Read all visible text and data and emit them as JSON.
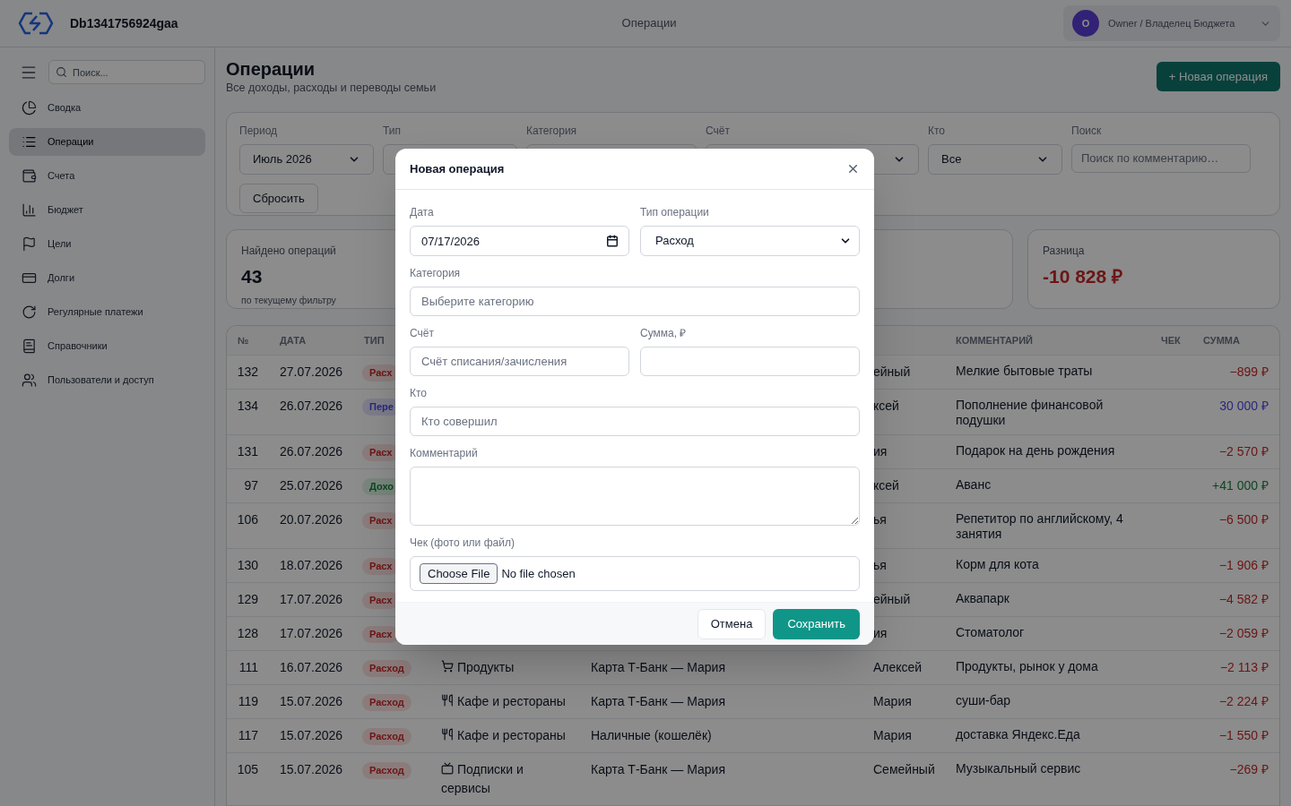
{
  "app": {
    "name": "Db1341756924gaa"
  },
  "header": {
    "title": "Операции",
    "user": {
      "initial": "О",
      "label": "Owner / Владелец Бюджета"
    }
  },
  "sidebar": {
    "search_placeholder": "Поиск...",
    "items": [
      {
        "label": "Сводка",
        "selected": false
      },
      {
        "label": "Операции",
        "selected": true
      },
      {
        "label": "Счета",
        "selected": false
      },
      {
        "label": "Бюджет",
        "selected": false
      },
      {
        "label": "Цели",
        "selected": false
      },
      {
        "label": "Долги",
        "selected": false
      },
      {
        "label": "Регулярные платежи",
        "selected": false
      },
      {
        "label": "Справочники",
        "selected": false
      },
      {
        "label": "Пользователи и доступ",
        "selected": false
      }
    ]
  },
  "page": {
    "title": "Операции",
    "subtitle": "Все доходы, расходы и переводы семьи",
    "new_button": "+ Новая операция"
  },
  "filters": {
    "fields": [
      {
        "label": "Период",
        "kind": "select",
        "value": "Июль 2026"
      },
      {
        "label": "Тип",
        "kind": "select"
      },
      {
        "label": "Категория",
        "kind": "select"
      },
      {
        "label": "Счёт",
        "kind": "select"
      },
      {
        "label": "Кто",
        "kind": "select",
        "value": "Все"
      },
      {
        "label": "Поиск",
        "kind": "input",
        "placeholder": "Поиск по комментарию…"
      }
    ],
    "reset": "Сбросить"
  },
  "summary": {
    "found": {
      "label": "Найдено операций",
      "value": "43",
      "note": "по текущему фильтру"
    },
    "difference": {
      "label": "Разница",
      "value": "-10 828 ₽",
      "kind": "expense"
    }
  },
  "table": {
    "columns": [
      "№",
      "ДАТА",
      "ТИП",
      "КОММЕНТАРИЙ",
      "ЧЕК",
      "СУММА"
    ],
    "rows": [
      {
        "num": "132",
        "date": "27.07.2026",
        "kind": "expense",
        "type": "Расх",
        "who": "ейный",
        "comment": "Мелкие бытовые траты",
        "amount": "−899 ₽"
      },
      {
        "num": "134",
        "date": "26.07.2026",
        "kind": "transfer",
        "type": "Пере",
        "who": "ксей",
        "comment": "Пополнение финансовой подушки",
        "amount": "30 000 ₽"
      },
      {
        "num": "131",
        "date": "26.07.2026",
        "kind": "expense",
        "type": "Расх",
        "who": "ия",
        "comment": "Подарок на день рождения",
        "amount": "−2 570 ₽"
      },
      {
        "num": "97",
        "date": "25.07.2026",
        "kind": "income",
        "type": "Дохо",
        "who": "ксей",
        "comment": "Аванс",
        "amount": "+41 000 ₽"
      },
      {
        "num": "106",
        "date": "20.07.2026",
        "kind": "expense",
        "type": "Расх",
        "who": "ья",
        "comment": "Репетитор по английскому, 4 занятия",
        "amount": "−6 500 ₽"
      },
      {
        "num": "130",
        "date": "18.07.2026",
        "kind": "expense",
        "type": "Расх",
        "who": "ья",
        "comment": "Корм для кота",
        "amount": "−1 906 ₽"
      },
      {
        "num": "129",
        "date": "17.07.2026",
        "kind": "expense",
        "type": "Расх",
        "who": "ейный",
        "comment": "Аквапарк",
        "amount": "−4 582 ₽"
      },
      {
        "num": "128",
        "date": "17.07.2026",
        "kind": "expense",
        "type": "Расх",
        "who": "ия",
        "comment": "Стоматолог",
        "amount": "−2 059 ₽"
      },
      {
        "num": "111",
        "date": "16.07.2026",
        "kind": "expense",
        "type": "Расход",
        "category": {
          "kind": "groceries",
          "label": "Продукты"
        },
        "account": "Карта Т-Банк — Мария",
        "who": "Алексей",
        "comment": "Продукты, рынок у дома",
        "amount": "−2 113 ₽"
      },
      {
        "num": "119",
        "date": "15.07.2026",
        "kind": "expense",
        "type": "Расход",
        "category": {
          "kind": "dining",
          "label": "Кафе и рестораны"
        },
        "account": "Карта Т-Банк — Мария",
        "who": "Мария",
        "comment": "суши-бар",
        "amount": "−2 224 ₽"
      },
      {
        "num": "117",
        "date": "15.07.2026",
        "kind": "expense",
        "type": "Расход",
        "category": {
          "kind": "dining",
          "label": "Кафе и рестораны"
        },
        "account": "Наличные (кошелёк)",
        "who": "Мария",
        "comment": "доставка Яндекс.Еда",
        "amount": "−1 550 ₽"
      },
      {
        "num": "105",
        "date": "15.07.2026",
        "kind": "expense",
        "type": "Расход",
        "category": {
          "kind": "subscriptions",
          "label": "Подписки и сервисы"
        },
        "account": "Карта Т-Банк — Мария",
        "who": "Семейный",
        "comment": "Музыкальный сервис",
        "amount": "−269 ₽"
      }
    ]
  },
  "dialog": {
    "title": "Новая операция",
    "rows": [
      [
        {
          "label": "Дата",
          "kind": "date",
          "value": "07/17/2026"
        },
        {
          "label": "Тип операции",
          "kind": "select",
          "value": "Расход"
        }
      ],
      [
        {
          "label": "Категория",
          "kind": "input",
          "placeholder": "Выберите категорию"
        }
      ],
      [
        {
          "label": "Счёт",
          "kind": "input",
          "placeholder": "Счёт списания/зачисления"
        },
        {
          "label": "Сумма, ₽",
          "kind": "input"
        }
      ],
      [
        {
          "label": "Кто",
          "kind": "input",
          "placeholder": "Кто совершил"
        }
      ],
      [
        {
          "label": "Комментарий",
          "kind": "textarea"
        }
      ],
      [
        {
          "label": "Чек (фото или файл)",
          "kind": "file",
          "button": "Choose File",
          "status": "No file chosen"
        }
      ]
    ],
    "cancel": "Отмена",
    "save": "Сохранить"
  }
}
